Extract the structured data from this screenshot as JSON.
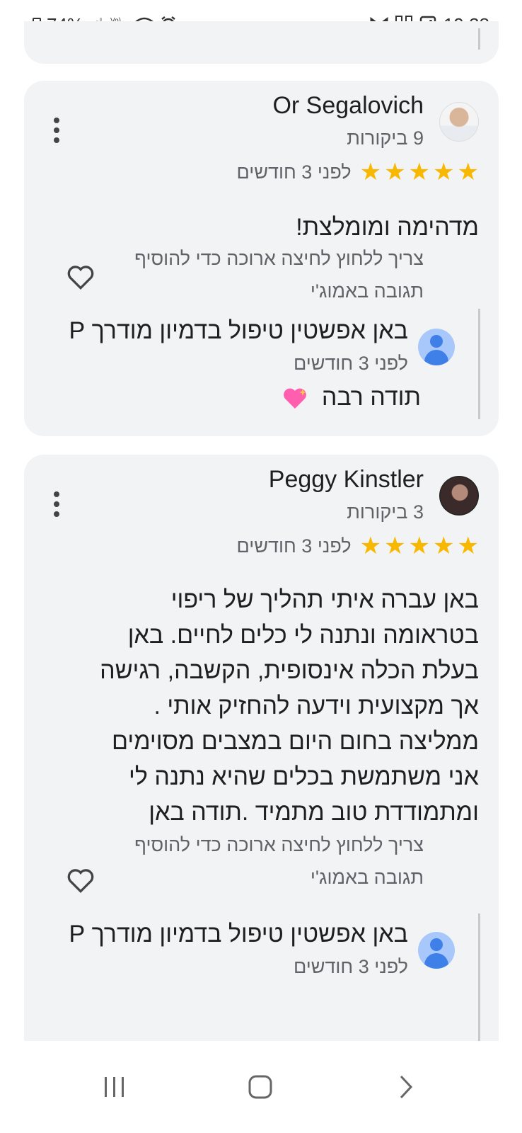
{
  "status_bar": {
    "battery": "74%",
    "time": "19:38",
    "icons": [
      "battery-icon",
      "signal-icon",
      "volte-icon",
      "wifi-icon",
      "alarm-icon",
      "dot-icon",
      "gmail-icon",
      "qr-icon",
      "gallery-icon"
    ],
    "volte_label": "Vo) LTE"
  },
  "reviews": [
    {
      "author": "Or Segalovich",
      "review_count": "9 ביקורות",
      "rating": 5,
      "time": "לפני 3 חודשים",
      "text": "מדהימה ומומלצת!",
      "hint_lines": [
        "צריך ללחוץ לחיצה ארוכה כדי להוסיף",
        "תגובה באמוג'י"
      ],
      "owner_reply": {
        "name": "באן אפשטין טיפול בדמיון מודרך P",
        "time": "לפני 3 חודשים",
        "text": "תודה רבה"
      }
    },
    {
      "author": "Peggy Kinstler",
      "review_count": "3 ביקורות",
      "rating": 5,
      "time": "לפני 3 חודשים",
      "text_lines": [
        "באן עברה איתי תהליך של ריפוי",
        "בטראומה ונתנה לי כלים לחיים. באן",
        "בעלת הכלה אינסופית, הקשבה, רגישה",
        "אך מקצועית וידעה להחזיק אותי .",
        "ממליצה בחום היום במצבים מסוימים",
        "אני משתמשת בכלים שהיא נתנה לי",
        "ומתמודדת טוב מתמיד .תודה באן"
      ],
      "hint_lines": [
        "צריך ללחוץ לחיצה ארוכה כדי להוסיף",
        "תגובה באמוג'י"
      ],
      "owner_reply": {
        "name": "באן אפשטין טיפול בדמיון מודרך P",
        "time": "לפני 3 חודשים"
      }
    }
  ],
  "nav": {
    "recents": "recents-icon",
    "home": "home-icon",
    "back": "back-icon"
  }
}
